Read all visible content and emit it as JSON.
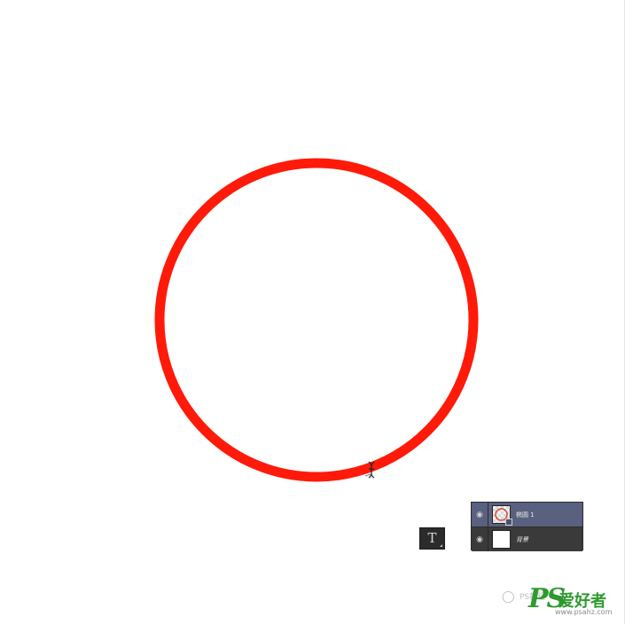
{
  "canvas": {
    "background": "#ffffff",
    "ring_color": "#ff1a0a"
  },
  "cursor": {
    "icon": "text-cursor-icon"
  },
  "toolbar": {
    "type_tool_label": "T",
    "type_tool_icon": "type-tool-icon"
  },
  "layers": {
    "rows": [
      {
        "name": "椭圆 1",
        "visibility_icon": "eye-icon",
        "thumbnail": "shape-layer-thumbnail",
        "selected": true
      },
      {
        "name": "背景",
        "visibility_icon": "eye-icon",
        "thumbnail": "background-thumbnail",
        "selected": false
      }
    ]
  },
  "watermark": {
    "chat_icon": "wechat-icon",
    "small_text": "PS教程",
    "brand_ps": "PS",
    "brand_cn": "爱好者",
    "url": "www.psahz.com",
    "color": "#2e9a2e"
  }
}
